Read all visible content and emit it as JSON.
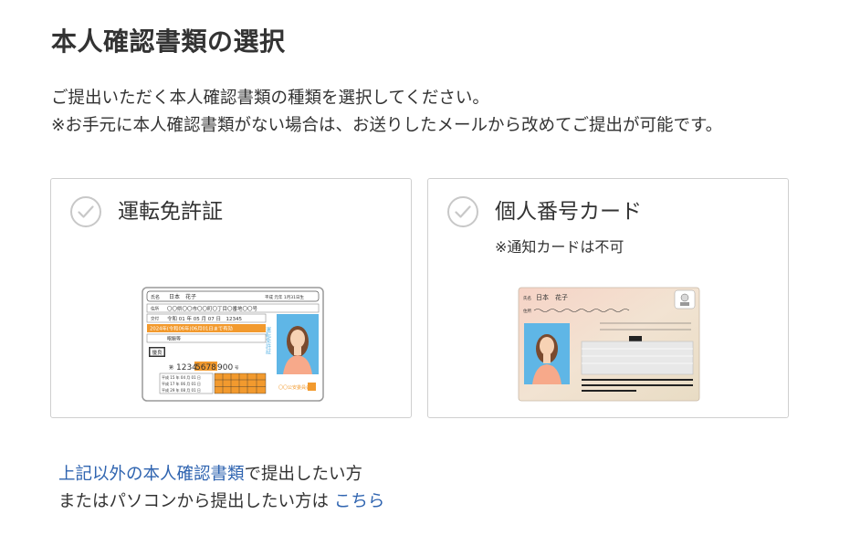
{
  "page": {
    "title": "本人確認書類の選択",
    "description_line1": "ご提出いただく本人確認書類の種類を選択してください。",
    "description_line2": "※お手元に本人確認書類がない場合は、お送りしたメールから改めてご提出が可能です。"
  },
  "options": [
    {
      "label": "運転免許証",
      "selected": false,
      "image_icon": "drivers-license-sample-image",
      "card_text": {
        "name_label": "氏名",
        "name": "日本　花子",
        "birth": "平成 元年 1月31日生",
        "address_label": "住所",
        "address": "〇〇県〇〇市〇〇町〇丁目〇番地〇〇号",
        "issue_label": "交付",
        "issue": "令和 01 年 05 月 07 日　12345",
        "expiry": "2024年(令和06年)06月01日まで有効",
        "condition": "眼鏡等",
        "badge": "優良",
        "number_label": "第",
        "number_prefix": "1234",
        "number_highlight": "5678",
        "number_suffix": "900",
        "number_unit": "号",
        "history": [
          "平成 15 年 04 月 01 日",
          "平成 17 年 06 月 01 日",
          "平成 29 年 08 月 01 日"
        ],
        "vertical_label": "運転免許証",
        "authority": "〇〇公安委員会"
      }
    },
    {
      "label": "個人番号カード",
      "note": "※通知カードは不可",
      "selected": false,
      "image_icon": "my-number-card-sample-image",
      "card_text": {
        "name_label": "氏名",
        "name": "日本　花子",
        "address_label": "住所"
      }
    }
  ],
  "footer": {
    "line1_link": "上記以外の本人確認書類",
    "line1_text": "で提出したい方",
    "line2_text": "またはパソコンから提出したい方は ",
    "line2_link": "こちら"
  },
  "colors": {
    "link": "#2f64b0",
    "check": "#c8c8c8",
    "border": "#cfcfcf",
    "license_accent": "#f29a2e",
    "license_blue": "#5fb6e6",
    "mynumber_bg": "#f3d7c9"
  }
}
